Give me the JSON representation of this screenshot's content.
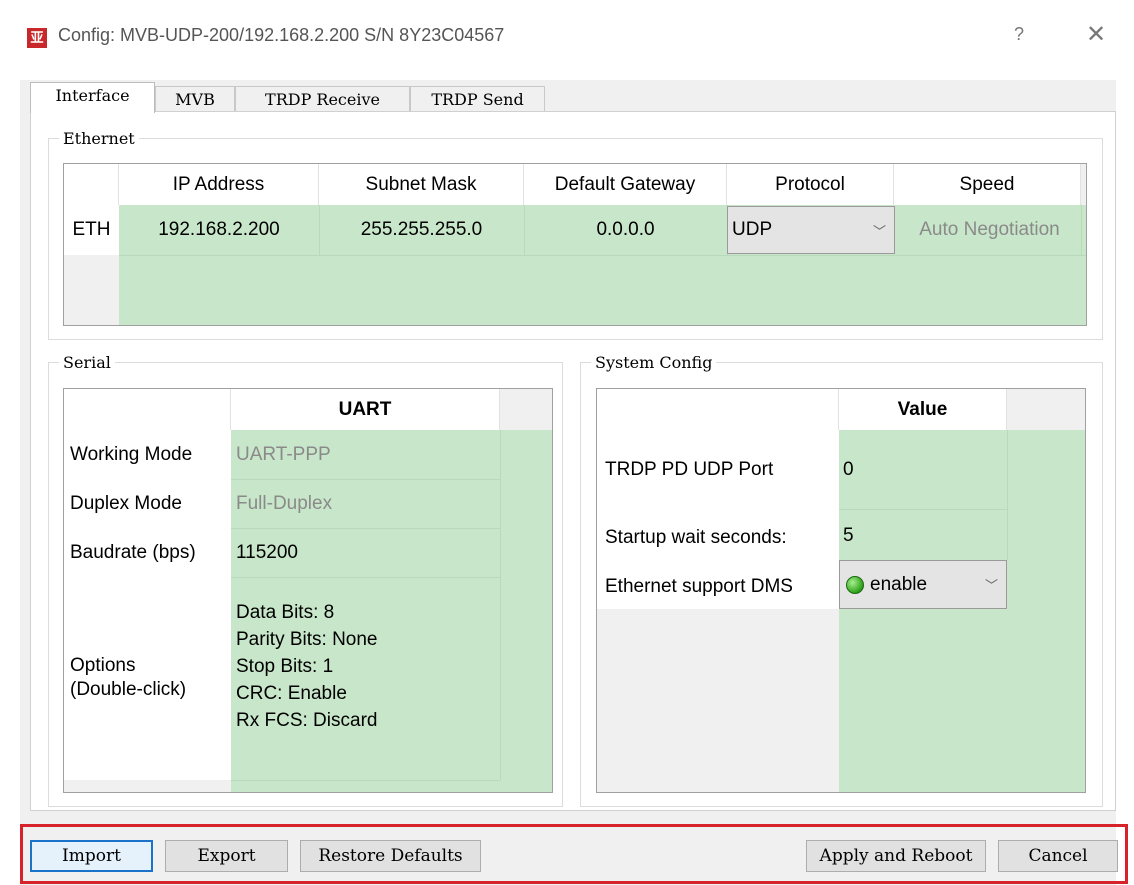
{
  "window": {
    "icon_glyph": "亚",
    "title": "Config: MVB-UDP-200/192.168.2.200  S/N 8Y23C04567",
    "help_glyph": "?",
    "close_glyph": "✕"
  },
  "tabs": [
    {
      "label": "Interface",
      "active": true
    },
    {
      "label": "MVB",
      "active": false
    },
    {
      "label": "TRDP Receive",
      "active": false
    },
    {
      "label": "TRDP Send",
      "active": false
    }
  ],
  "ethernet": {
    "group_title": "Ethernet",
    "headers": [
      "IP Address",
      "Subnet Mask",
      "Default Gateway",
      "Protocol",
      "Speed"
    ],
    "row_label": "ETH",
    "ip": "192.168.2.200",
    "mask": "255.255.255.0",
    "gateway": "0.0.0.0",
    "protocol": "UDP",
    "speed": "Auto Negotiation"
  },
  "serial": {
    "group_title": "Serial",
    "header": "UART",
    "rows": [
      {
        "label": "Working Mode",
        "value": "UART-PPP"
      },
      {
        "label": "Duplex Mode",
        "value": "Full-Duplex"
      },
      {
        "label": "Baudrate (bps)",
        "value": "115200"
      }
    ],
    "options_label_1": "Options",
    "options_label_2": "(Double-click)",
    "options": [
      "Data Bits: 8",
      "Parity Bits: None",
      "Stop Bits: 1",
      "CRC: Enable",
      "Rx FCS: Discard"
    ]
  },
  "system": {
    "group_title": "System Config",
    "header": "Value",
    "rows": [
      {
        "label": "TRDP PD UDP Port",
        "value": "0"
      },
      {
        "label": "Startup wait seconds:",
        "value": "5"
      },
      {
        "label": "Ethernet support DMS",
        "value": "enable"
      }
    ]
  },
  "buttons": {
    "import": "Import",
    "export": "Export",
    "restore": "Restore Defaults",
    "apply": "Apply and Reboot",
    "cancel": "Cancel"
  },
  "colors": {
    "cell_green": "#c8e6c9",
    "highlight_red": "#d6222a",
    "focus_blue": "#1a73c9"
  }
}
